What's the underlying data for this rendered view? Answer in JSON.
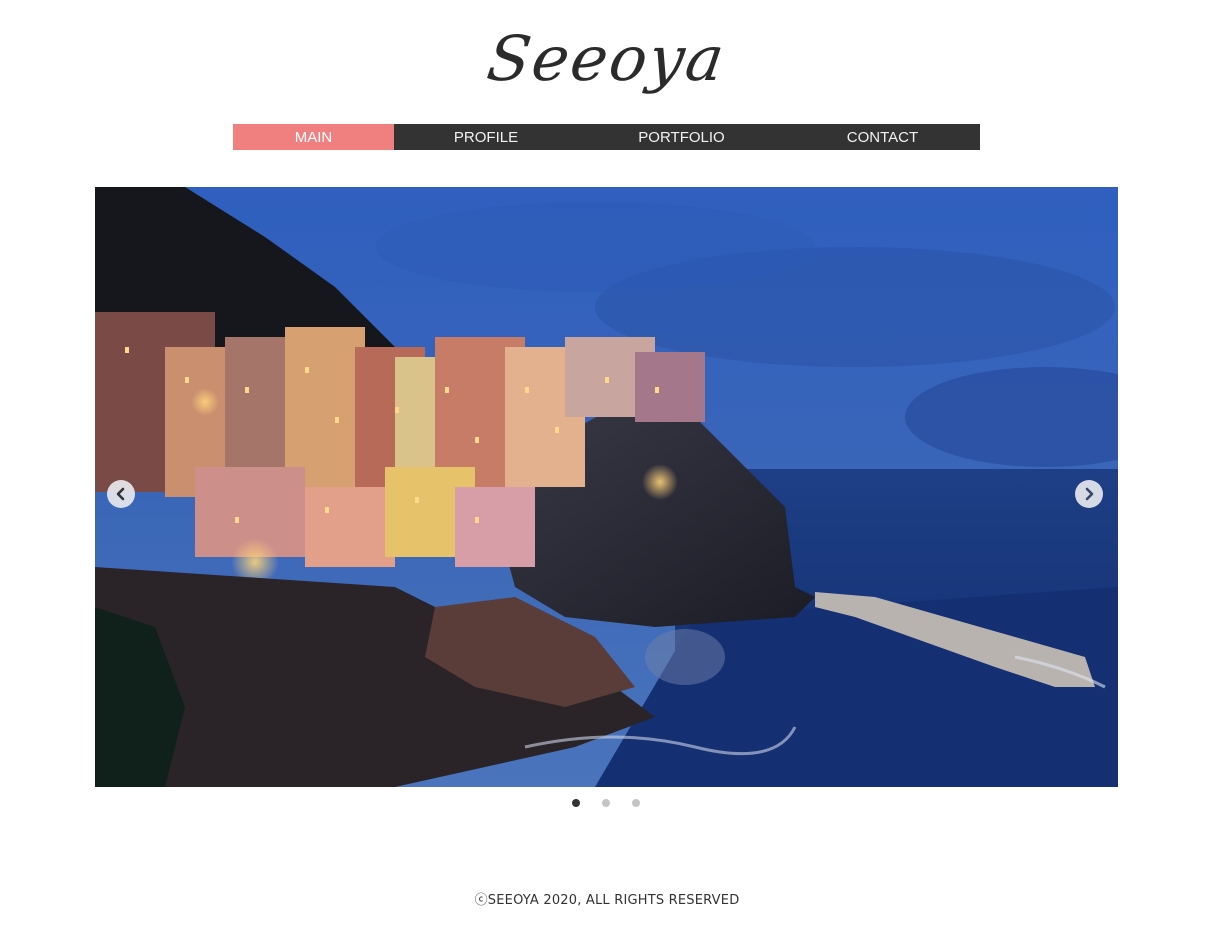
{
  "brand": {
    "logo": "Seeoya"
  },
  "nav": {
    "items": [
      {
        "label": "MAIN",
        "active": true
      },
      {
        "label": "PROFILE",
        "active": false
      },
      {
        "label": "PORTFOLIO",
        "active": false
      },
      {
        "label": "CONTACT",
        "active": false
      }
    ],
    "colors": {
      "bar": "#333333",
      "active": "#f08080"
    }
  },
  "slider": {
    "slide_count": 3,
    "active_index": 0,
    "prev_icon": "chevron-left-icon",
    "next_icon": "chevron-right-icon"
  },
  "footer": {
    "text": "ⓒSEEOYA 2020, ALL RIGHTS RESERVED"
  }
}
